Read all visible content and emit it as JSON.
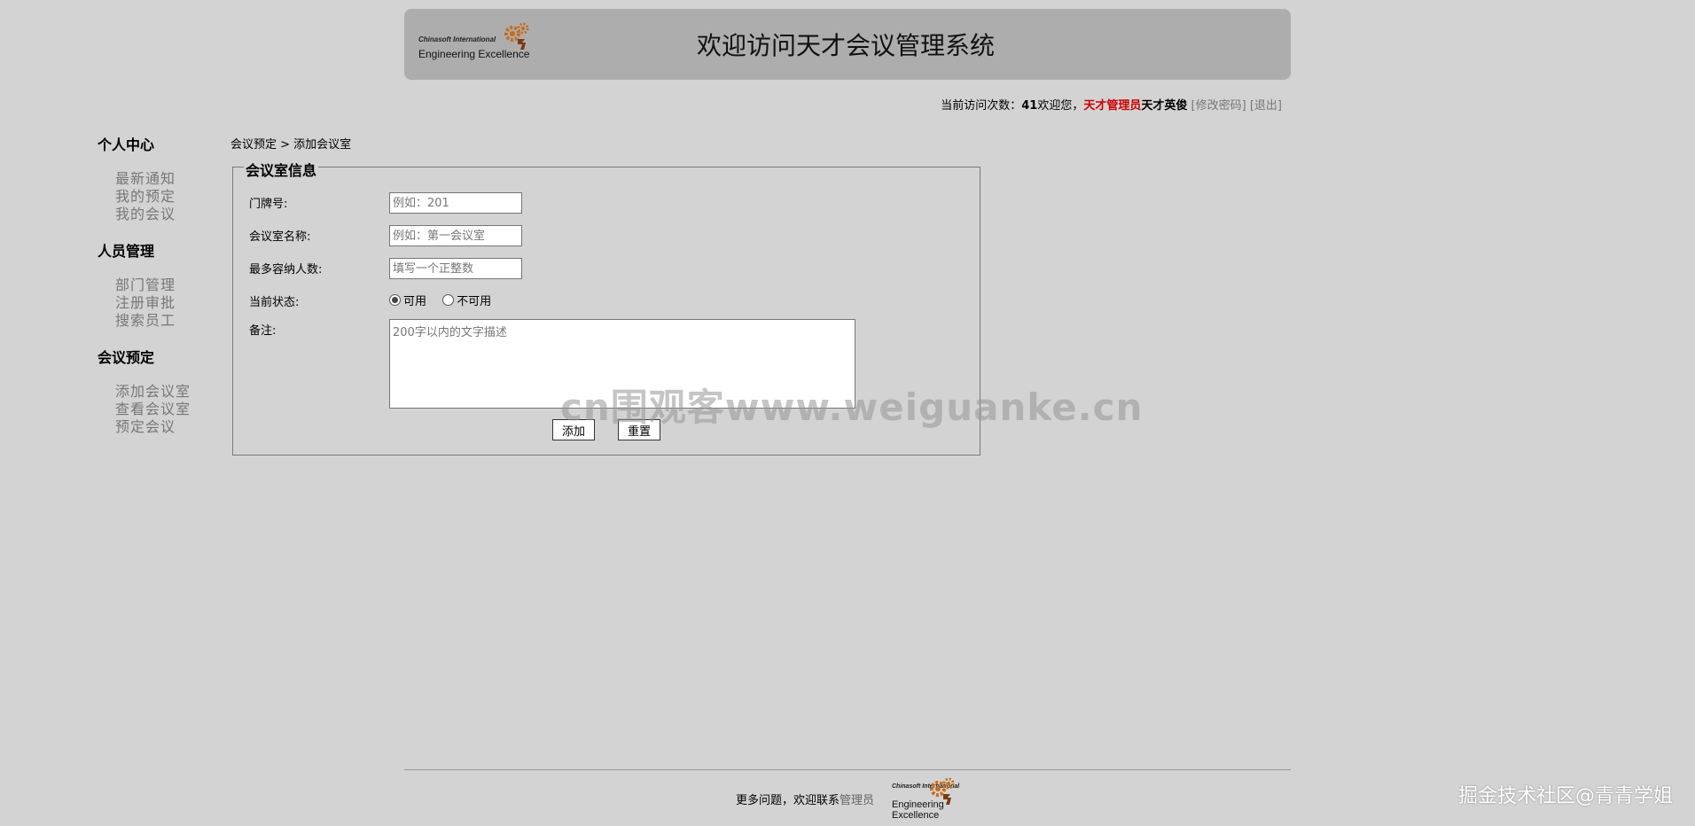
{
  "header": {
    "logo_line1": "Chinasoft International",
    "logo_line2": "Engineering Excellence",
    "title": "欢迎访问天才会议管理系统"
  },
  "userbar": {
    "visits_label": "当前访问次数：",
    "visits_count": "41",
    "welcome": "欢迎您，",
    "role": "天才管理员",
    "username": "天才英俊",
    "change_password": "[修改密码]",
    "logout": "[退出]"
  },
  "sidebar": {
    "groups": [
      {
        "title": "个人中心",
        "items": [
          "最新通知",
          "我的预定",
          "我的会议"
        ]
      },
      {
        "title": "人员管理",
        "items": [
          "部门管理",
          "注册审批",
          "搜索员工"
        ]
      },
      {
        "title": "会议预定",
        "items": [
          "添加会议室",
          "查看会议室",
          "预定会议"
        ]
      }
    ]
  },
  "breadcrumb": "会议预定 > 添加会议室",
  "form": {
    "legend": "会议室信息",
    "room_number_label": "门牌号:",
    "room_number_placeholder": "例如：201",
    "room_name_label": "会议室名称:",
    "room_name_placeholder": "例如：第一会议室",
    "capacity_label": "最多容纳人数:",
    "capacity_placeholder": "填写一个正整数",
    "status_label": "当前状态:",
    "status_options": [
      "可用",
      "不可用"
    ],
    "status_selected": "可用",
    "remark_label": "备注:",
    "remark_placeholder": "200字以内的文字描述",
    "add_button": "添加",
    "reset_button": "重置"
  },
  "watermark": "cn围观客www.weiguanke.cn",
  "footer": {
    "text": "更多问题，欢迎联系",
    "admin_link": "管理员",
    "logo_line1": "Chinasoft International",
    "logo_line2": "Engineering Excellence"
  },
  "corner_mark": "掘金技术社区@青青学姐",
  "colors": {
    "background": "#d3d3d3",
    "header": "#adadad",
    "role": "#cc0000"
  }
}
